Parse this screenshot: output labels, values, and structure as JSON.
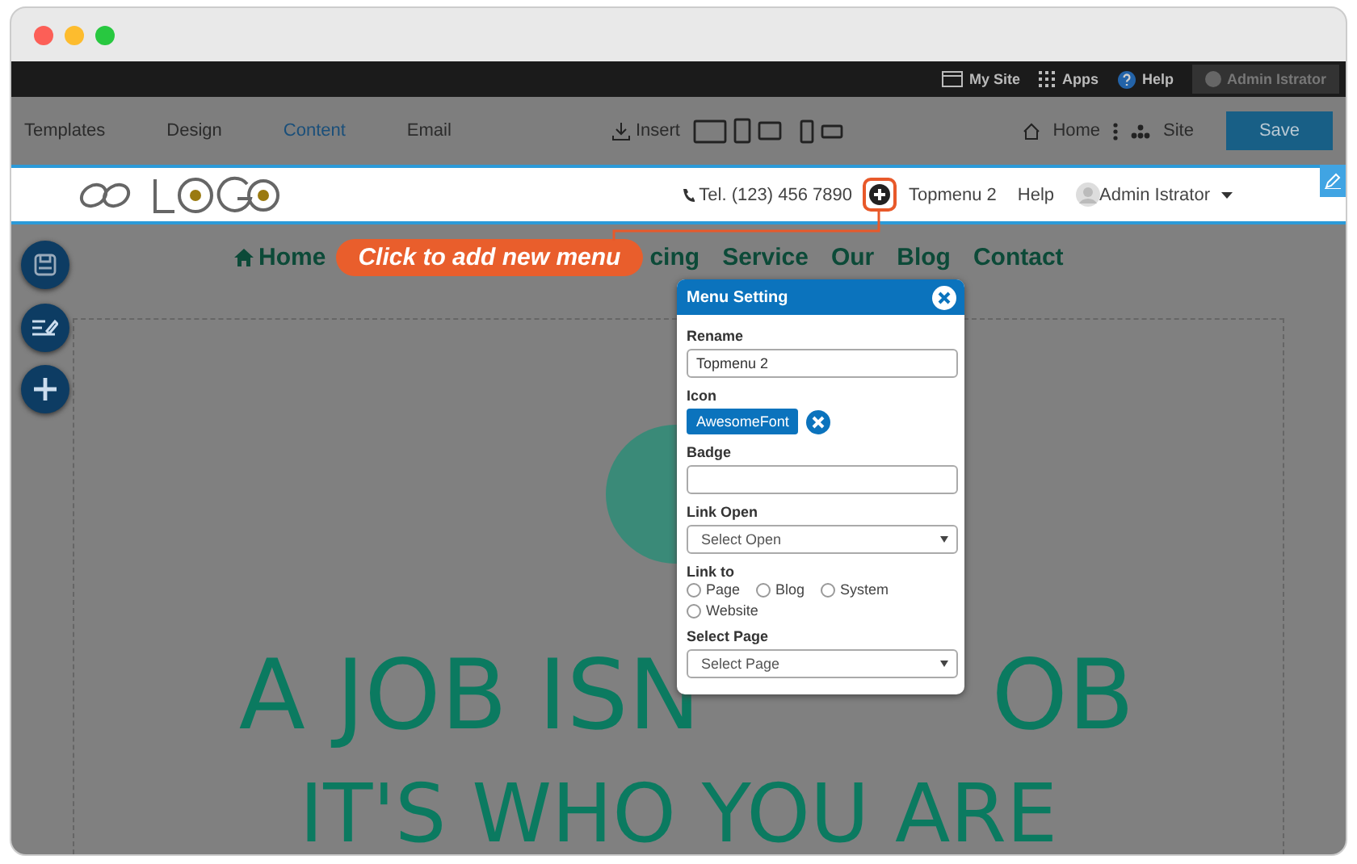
{
  "top_bar": {
    "items": [
      {
        "kind": "window",
        "label": "My Site"
      },
      {
        "kind": "grid",
        "label": "Apps"
      },
      {
        "kind": "help",
        "label": "Help"
      }
    ],
    "user": "Admin Istrator"
  },
  "toolbar": {
    "tabs": [
      {
        "label": "Templates",
        "selected": false
      },
      {
        "label": "Design",
        "selected": false
      },
      {
        "label": "Content",
        "selected": true
      },
      {
        "label": "Email",
        "selected": false
      }
    ],
    "insert": "Insert",
    "home": "Home",
    "site": "Site",
    "save": "Save"
  },
  "site_header": {
    "phone": "Tel. (123) 456 7890",
    "menu": [
      "Topmenu 2",
      "Help"
    ],
    "user": "Admin Istrator"
  },
  "nav": [
    "Home",
    "cing",
    "Service",
    "Our",
    "Blog",
    "Contact"
  ],
  "tooltip": "Click to add new menu",
  "hero": {
    "line1_left": "A JOB ISN",
    "line1_right": "OB",
    "line2": "IT'S WHO YOU ARE"
  },
  "menu_setting": {
    "title": "Menu Setting",
    "rename": {
      "label": "Rename",
      "value": "Topmenu 2"
    },
    "icon": {
      "label": "Icon",
      "value": "AwesomeFont"
    },
    "badge": {
      "label": "Badge"
    },
    "link_open": {
      "label": "Link Open",
      "value": "Select Open"
    },
    "link_to": {
      "label": "Link to",
      "options": [
        {
          "label": "Page",
          "selected": false
        },
        {
          "label": "Blog",
          "selected": false
        },
        {
          "label": "System",
          "selected": false
        },
        {
          "label": "Website",
          "selected": false
        }
      ]
    },
    "select_page": {
      "label": "Select Page",
      "value": "Select Page"
    }
  }
}
